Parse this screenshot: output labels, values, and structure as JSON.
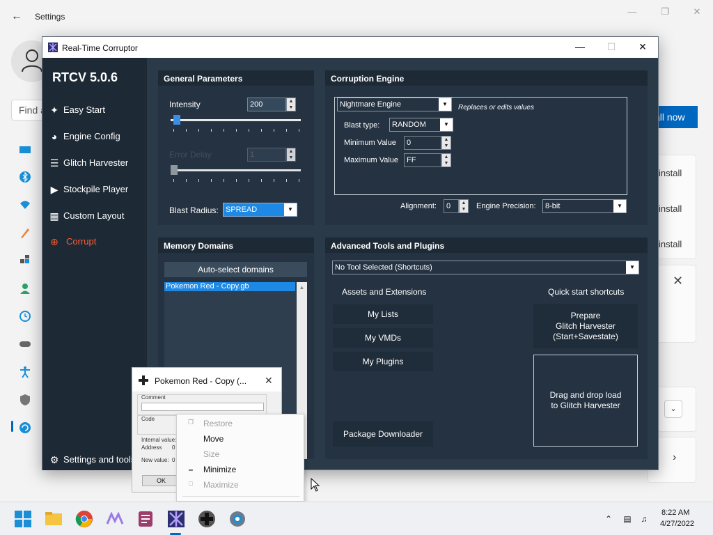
{
  "settings": {
    "title": "Settings",
    "find_placeholder": "Find a",
    "install_now": "all now",
    "install_labels": [
      "install",
      "install",
      "install"
    ]
  },
  "rtc": {
    "window_title": "Real-Time Corruptor",
    "version": "RTCV 5.0.6",
    "nav": {
      "easy_start": "Easy Start",
      "engine_config": "Engine Config",
      "glitch_harvester": "Glitch Harvester",
      "stockpile_player": "Stockpile Player",
      "custom_layout": "Custom Layout",
      "corrupt": "Corrupt",
      "settings_tools": "Settings and tools"
    },
    "general": {
      "header": "General Parameters",
      "intensity_label": "Intensity",
      "intensity_value": "200",
      "intensity_level": 0.02,
      "error_delay_label": "Error Delay",
      "error_delay_value": "1",
      "error_delay_level": 0.0,
      "blast_radius_label": "Blast Radius:",
      "blast_radius_value": "SPREAD"
    },
    "engine": {
      "header": "Corruption Engine",
      "engine_value": "Nightmare Engine",
      "engine_desc": "Replaces or edits values",
      "blast_type_label": "Blast type:",
      "blast_type_value": "RANDOM",
      "min_label": "Minimum Value",
      "min_value": "0",
      "max_label": "Maximum Value",
      "max_value": "FF",
      "alignment_label": "Alignment:",
      "alignment_value": "0",
      "precision_label": "Engine Precision:",
      "precision_value": "8-bit"
    },
    "memory": {
      "header": "Memory Domains",
      "auto_select": "Auto-select domains",
      "domains": [
        "Pokemon Red - Copy.gb"
      ]
    },
    "advanced": {
      "header": "Advanced Tools and Plugins",
      "tool_select": "No Tool Selected (Shortcuts)",
      "assets_header": "Assets and Extensions",
      "my_lists": "My Lists",
      "my_vmds": "My VMDs",
      "my_plugins": "My Plugins",
      "package_downloader": "Package Downloader",
      "quick_header": "Quick start shortcuts",
      "prepare_line1": "Prepare",
      "prepare_line2": "Glitch Harvester",
      "prepare_line3": "(Start+Savestate)",
      "drag_line1": "Drag and drop load",
      "drag_line2": "to Glitch Harvester"
    }
  },
  "poke_dialog": {
    "title": "Pokemon Red - Copy (...",
    "comment_label": "Comment",
    "code_label": "Code",
    "internal_label": "Internal value:",
    "address_label": "Address",
    "address_value": "0",
    "new_value_label": "New value:",
    "new_value_value": "0",
    "ok": "OK"
  },
  "context_menu": {
    "items": [
      "Restore",
      "Move",
      "Size",
      "Minimize",
      "Maximize"
    ]
  },
  "taskbar": {
    "time": "8:22 AM",
    "date": "4/27/2022"
  },
  "colors": {
    "rtc_bg": "#2b3a48",
    "rtc_panel": "#243241",
    "rtc_sidebar": "#1d2a36",
    "corrupt_accent": "#ff5b30",
    "selection_blue": "#1e88e5",
    "windows_accent": "#0067c0"
  }
}
